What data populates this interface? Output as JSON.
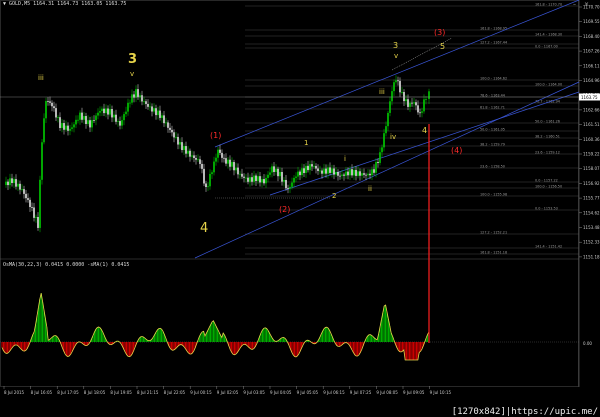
{
  "header": {
    "title": "▼ GOLD,M5  1164.31 1164.73 1163.05 1163.75",
    "osma": "OsMA(30,22,3) 0.0415 0.0000  -sMA(1) 0.0415"
  },
  "window_buttons": {
    "minimize": "–",
    "close": "×"
  },
  "footer": "[1270x842]|https://upic.me/",
  "colors": {
    "background": "#000000",
    "bull_candle": "#00d000",
    "bear_candle": "#e6e6e6",
    "channel": "#3a56d8",
    "fib": "#777777",
    "wave_yellow": "#e7d44a",
    "wave_red": "#ff2a2a",
    "osma_up": "#00c000",
    "osma_down": "#e00000"
  },
  "price_axis": {
    "labels": [
      "1170.70",
      "1169.55",
      "1168.40",
      "1167.26",
      "1166.11",
      "1164.96",
      "1163.81",
      "1162.66",
      "1161.51",
      "1160.36",
      "1159.22",
      "1158.07",
      "1156.92",
      "1155.77",
      "1154.62",
      "1153.48",
      "1152.33",
      "1151.18"
    ],
    "current_price": "1163.75",
    "osma_labels": [
      "0.00"
    ]
  },
  "time_axis": [
    "8 Jul 2015",
    "8 Jul 16:05",
    "8 Jul 17:05",
    "8 Jul 18:05",
    "8 Jul 19:05",
    "8 Jul 21:15",
    "8 Jul 22:05",
    "9 Jul 00:15",
    "9 Jul 02:05",
    "9 Jul 03:05",
    "9 Jul 04:05",
    "9 Jul 05:05",
    "9 Jul 06:15",
    "9 Jul 07:25",
    "9 Jul 08:05",
    "9 Jul 09:05",
    "9 Jul 10:15"
  ],
  "fib_labels": [
    "161.8 - 1170.70",
    "161.8 - 1168.95",
    "141.4 - 1168.30",
    "127.2 - 1167.44",
    "0.0 - 1167.00",
    "100.0 - 1164.62",
    "100.0 - 1164.00",
    "78.6 - 1163.44",
    "70.7 - 1162.94",
    "61.8 - 1162.71",
    "50.0 - 1161.26",
    "50.0 - 1161.05",
    "38.2 - 1160.51",
    "38.2 - 1159.79",
    "23.6 - 1159.12",
    "23.6 - 1158.50",
    "0.0 - 1157.22",
    "100.0 - 1155.98",
    "0.0 - 1153.53",
    "127.2 - 1152.21",
    "141.4 - 1151.42",
    "161.8 - 1151.18",
    "100.0 - 1156.50"
  ],
  "wave_labels": {
    "major_3": "3",
    "major_4": "4",
    "major_3_v": "v",
    "major_3_iii": "iii",
    "red_1": "(1)",
    "red_2": "(2)",
    "red_3": "(3)",
    "red_4": "(4)",
    "w1": "1",
    "w2": "2",
    "wi": "i",
    "wii": "ii",
    "wiii": "iii",
    "wiv": "iv",
    "w3": "3",
    "w5": "5",
    "w4": "4",
    "wv": "v"
  }
}
